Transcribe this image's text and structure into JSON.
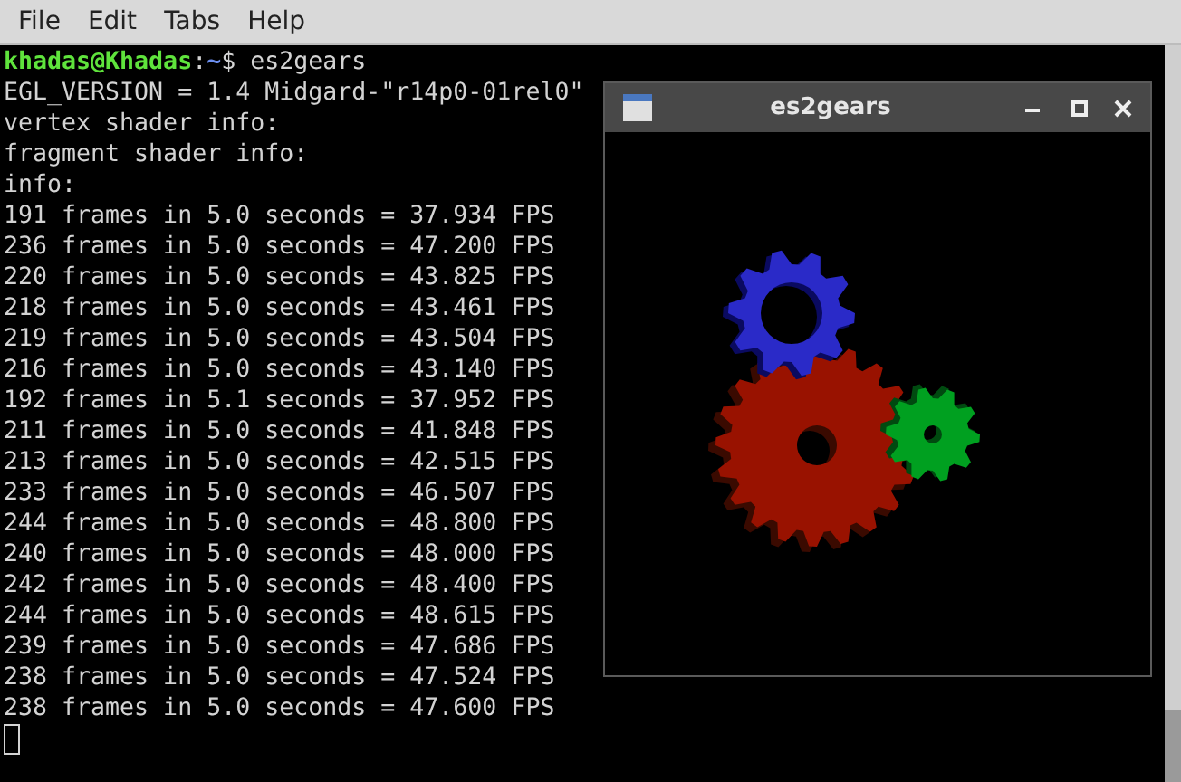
{
  "menu": [
    "File",
    "Edit",
    "Tabs",
    "Help"
  ],
  "terminal": {
    "prompt": {
      "user_host": "khadas@Khadas",
      "separator": ":",
      "path": "~",
      "symbol": "$",
      "command": "es2gears"
    },
    "output": [
      "EGL_VERSION = 1.4 Midgard-\"r14p0-01rel0\"",
      "vertex shader info:",
      "fragment shader info:",
      "info:",
      "191 frames in 5.0 seconds = 37.934 FPS",
      "236 frames in 5.0 seconds = 47.200 FPS",
      "220 frames in 5.0 seconds = 43.825 FPS",
      "218 frames in 5.0 seconds = 43.461 FPS",
      "219 frames in 5.0 seconds = 43.504 FPS",
      "216 frames in 5.0 seconds = 43.140 FPS",
      "192 frames in 5.1 seconds = 37.952 FPS",
      "211 frames in 5.0 seconds = 41.848 FPS",
      "213 frames in 5.0 seconds = 42.515 FPS",
      "233 frames in 5.0 seconds = 46.507 FPS",
      "244 frames in 5.0 seconds = 48.800 FPS",
      "240 frames in 5.0 seconds = 48.000 FPS",
      "242 frames in 5.0 seconds = 48.400 FPS",
      "244 frames in 5.0 seconds = 48.615 FPS",
      "239 frames in 5.0 seconds = 47.686 FPS",
      "238 frames in 5.0 seconds = 47.524 FPS",
      "238 frames in 5.0 seconds = 47.600 FPS"
    ]
  },
  "gears_window": {
    "title": "es2gears"
  }
}
